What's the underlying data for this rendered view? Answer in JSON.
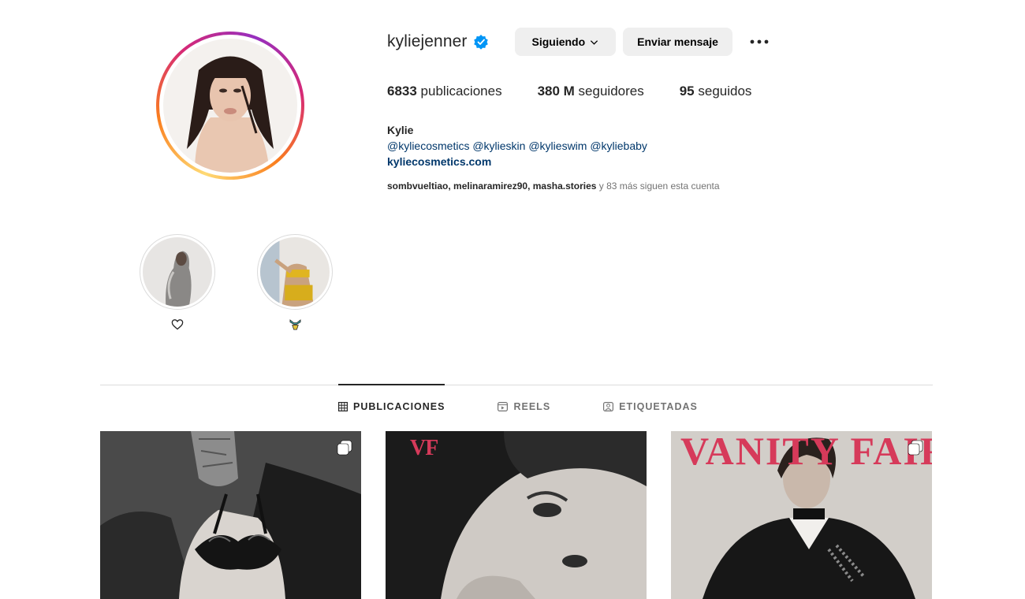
{
  "profile": {
    "username": "kyliejenner",
    "verified": true,
    "follow_label": "Siguiendo",
    "message_label": "Enviar mensaje",
    "more_icon": "ellipsis-icon"
  },
  "stats": {
    "posts_count": "6833",
    "posts_label": " publicaciones",
    "followers_count": "380 M",
    "followers_label": " seguidores",
    "following_count": "95",
    "following_label": " seguidos"
  },
  "bio": {
    "name": "Kylie",
    "mentions": "@kyliecosmetics @kylieskin @kylieswim @kyliebaby",
    "link": "kyliecosmetics.com"
  },
  "followed_by": {
    "names": "sombvueltiao, melinaramirez90, masha.stories",
    "suffix": " y 83 más siguen esta cuenta"
  },
  "highlights": [
    {
      "label_icon": "heart-icon"
    },
    {
      "label_icon": "bikini-emoji-icon"
    }
  ],
  "tabs": [
    {
      "label": "PUBLICACIONES",
      "icon": "grid-icon",
      "active": true
    },
    {
      "label": "REELS",
      "icon": "reels-icon",
      "active": false
    },
    {
      "label": "ETIQUETADAS",
      "icon": "tagged-icon",
      "active": false
    }
  ],
  "posts": [
    {
      "overlay_text": "",
      "multi": true
    },
    {
      "overlay_text": "VF",
      "multi": false
    },
    {
      "overlay_text": "VANITY FAIR",
      "multi": true
    }
  ],
  "colors": {
    "verified_blue": "#0095f6",
    "link_blue": "#00376b",
    "button_gray": "#efefef",
    "vanity_fair_red": "#d63a5a"
  }
}
